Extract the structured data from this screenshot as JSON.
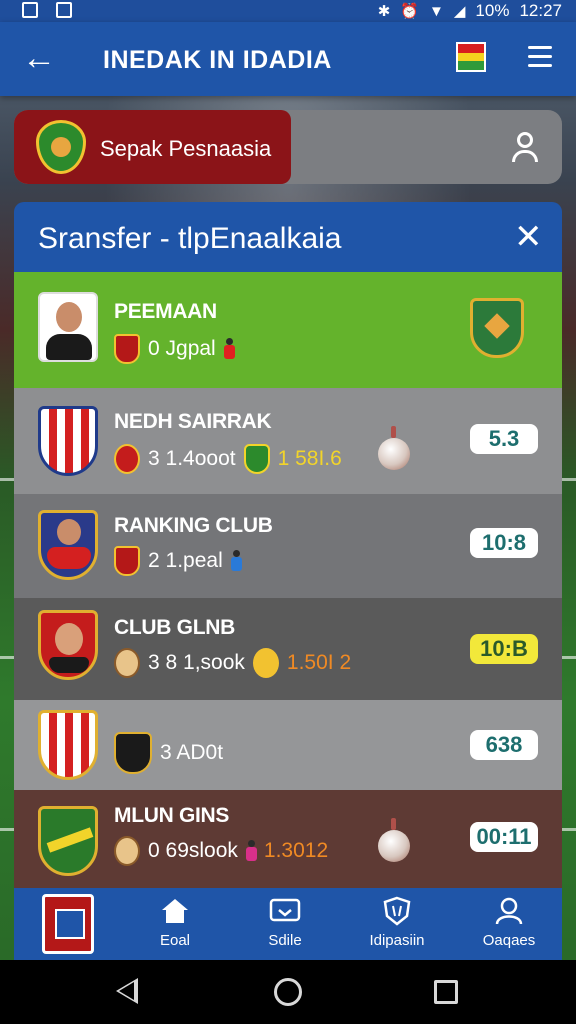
{
  "status_bar": {
    "battery": "10%",
    "time": "12:27"
  },
  "app_bar": {
    "title": "INEDAK IN IDADIA"
  },
  "search": {
    "league_name": "Sepak Pesnaasia"
  },
  "panel": {
    "title": "Sransfer - tlpEnaalkaia"
  },
  "rows": [
    {
      "name": "PEEMAAN",
      "detail": "0 Jgpal",
      "amount": "",
      "value": "",
      "bg": "#64b32c"
    },
    {
      "name": "NEDH SAIRRAK",
      "detail": "3 1.4ooot",
      "amount": "1 58I.6",
      "value": "5.3",
      "bg": "#8e8f91"
    },
    {
      "name": "RANKING CLUB",
      "detail": "2 1.peal",
      "amount": "",
      "value": "10:8",
      "bg": "#747578"
    },
    {
      "name": "CLUB GLNB",
      "detail": "3 8 1,sook",
      "amount": "1.50I 2",
      "value": "10:B",
      "bg": "#5a5a5a"
    },
    {
      "name": "",
      "detail": "3 AD0t",
      "amount": "",
      "value": "638",
      "bg": "#959698"
    },
    {
      "name": "MLUN GINS",
      "detail": "0 69slook",
      "amount": "1.3012",
      "value": "00:11",
      "bg": "#5e3a34"
    }
  ],
  "bottom_nav": {
    "items": [
      {
        "label": "Eoal",
        "icon": "home-icon"
      },
      {
        "label": "Sdile",
        "icon": "tv-icon"
      },
      {
        "label": "Idipasiin",
        "icon": "shield-icon"
      },
      {
        "label": "Oaqaes",
        "icon": "profile-icon"
      }
    ]
  },
  "colors": {
    "primary": "#1f55a8",
    "league_red": "#8b1418",
    "highlight_green": "#64b32c",
    "accent_orange": "#f08a24",
    "accent_yellow": "#f2d42a"
  }
}
